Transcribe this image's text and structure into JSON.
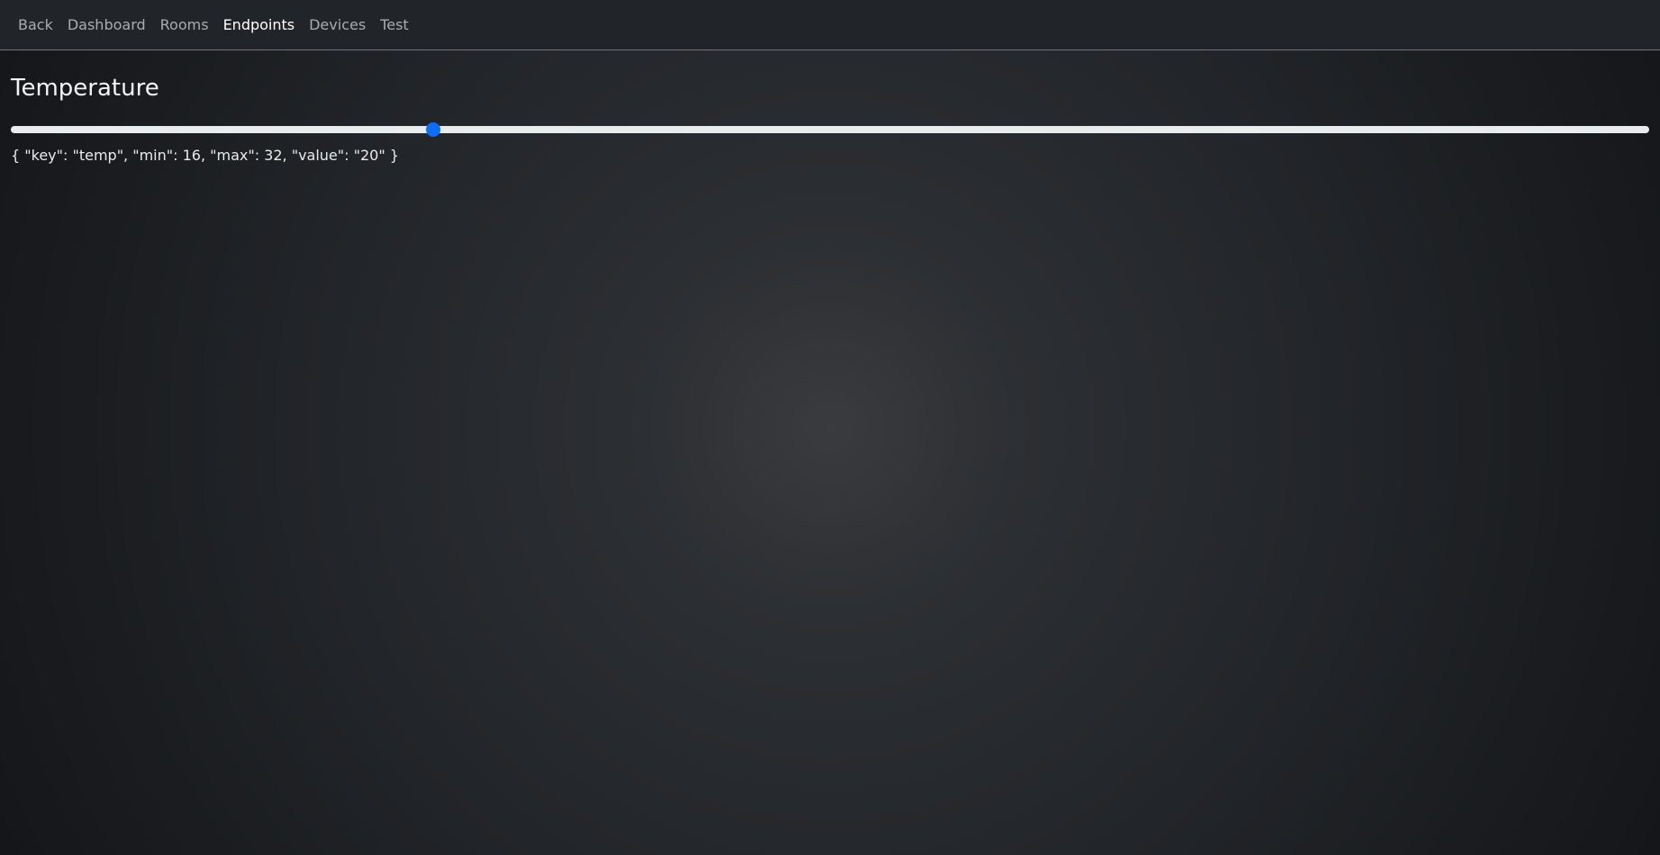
{
  "nav": {
    "items": [
      {
        "label": "Back"
      },
      {
        "label": "Dashboard"
      },
      {
        "label": "Rooms"
      },
      {
        "label": "Endpoints"
      },
      {
        "label": "Devices"
      },
      {
        "label": "Test"
      }
    ],
    "active": "Endpoints"
  },
  "main": {
    "title": "Temperature",
    "slider": {
      "min": 16,
      "max": 32,
      "value": 20
    },
    "json_text": "{ \"key\": \"temp\", \"min\": 16, \"max\": 32, \"value\": \"20\" }"
  },
  "colors": {
    "accent": "#0d6efd",
    "background": "#212529"
  }
}
